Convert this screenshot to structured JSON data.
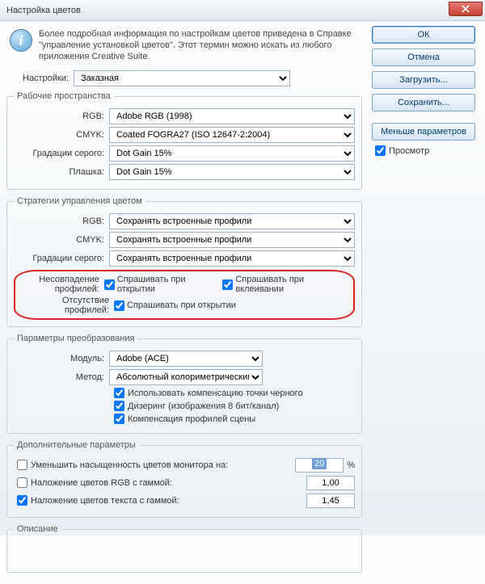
{
  "title": "Настройка цветов",
  "info_text": "Более подробная информация по настройкам цветов приведена в Справке \"управление установкой цветов\". Этот термин можно искать из любого приложения Creative Suite.",
  "settings_label": "Настройки:",
  "settings_value": "Заказная",
  "workspace": {
    "legend": "Рабочие пространства",
    "rgb_label": "RGB:",
    "rgb_value": "Adobe RGB (1998)",
    "cmyk_label": "CMYK:",
    "cmyk_value": "Coated FOGRA27 (ISO 12647-2:2004)",
    "gray_label": "Градации серого:",
    "gray_value": "Dot Gain 15%",
    "spot_label": "Плашка:",
    "spot_value": "Dot Gain 15%"
  },
  "policies": {
    "legend": "Стратегии управления цветом",
    "rgb_label": "RGB:",
    "rgb_value": "Сохранять встроенные профили",
    "cmyk_label": "CMYK:",
    "cmyk_value": "Сохранять встроенные профили",
    "gray_label": "Градации серого:",
    "gray_value": "Сохранять встроенные профили",
    "mismatch_label": "Несовпадение профилей:",
    "mismatch_ask_open": "Спрашивать при открытии",
    "mismatch_ask_paste": "Спрашивать при вклеивании",
    "missing_label": "Отсутствие профилей:",
    "missing_ask_open": "Спрашивать при открытии"
  },
  "conversion": {
    "legend": "Параметры преобразования",
    "engine_label": "Модуль:",
    "engine_value": "Adobe (ACE)",
    "intent_label": "Метод:",
    "intent_value": "Абсолютный колориметрический",
    "bpc": "Использовать компенсацию точки черного",
    "dither": "Дизеринг (изображения 8 бит/канал)",
    "scene": "Компенсация профилей сцены"
  },
  "advanced": {
    "legend": "Дополнительные параметры",
    "desat_label": "Уменьшить насыщенность цветов монитора на:",
    "desat_value": "20",
    "desat_unit": "%",
    "blend_rgb_label": "Наложение цветов RGB с гаммой:",
    "blend_rgb_value": "1,00",
    "blend_text_label": "Наложение цветов текста с гаммой:",
    "blend_text_value": "1,45"
  },
  "description_legend": "Описание",
  "buttons": {
    "ok": "ОК",
    "cancel": "Отмена",
    "load": "Загрузить...",
    "save": "Сохранить...",
    "less": "Меньше параметров",
    "preview": "Просмотр"
  }
}
